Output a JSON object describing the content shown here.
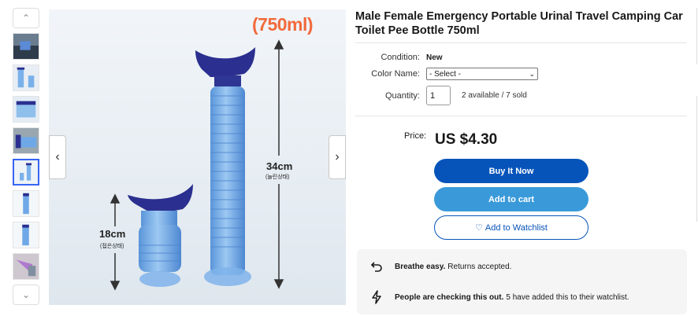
{
  "thumbnails": {
    "up_label": "⌃",
    "down_label": "⌄",
    "count": 8,
    "active_index": 4
  },
  "image": {
    "capacity_label": "(750ml)",
    "tall_height_label": "34cm",
    "tall_sub_label": "(늘린상태)",
    "short_height_label": "18cm",
    "short_sub_label": "(접은상태)",
    "prev_label": "‹",
    "next_label": "›"
  },
  "product": {
    "title": "Male Female Emergency Portable Urinal Travel Camping Car Toilet Pee Bottle 750ml",
    "condition_label": "Condition:",
    "condition_value": "New",
    "color_label": "Color Name:",
    "color_selected": "- Select -",
    "quantity_label": "Quantity:",
    "quantity_value": "1",
    "availability": "2 available / 7 sold",
    "price_label": "Price:",
    "price": "US $4.30"
  },
  "actions": {
    "buy_now": "Buy It Now",
    "add_to_cart": "Add to cart",
    "add_to_watchlist": "Add to Watchlist"
  },
  "info": {
    "returns_bold": "Breathe easy.",
    "returns_text": "Returns accepted.",
    "watch_bold": "People are checking this out.",
    "watch_text": "5 have added this to their watchlist."
  },
  "colors": {
    "accent_blue": "#0654ba",
    "cart_blue": "#3a9ad9",
    "capacity_orange": "#f26a3d",
    "funnel_navy": "#2b2f8f",
    "bottle_blue": "#6fa8e6"
  }
}
